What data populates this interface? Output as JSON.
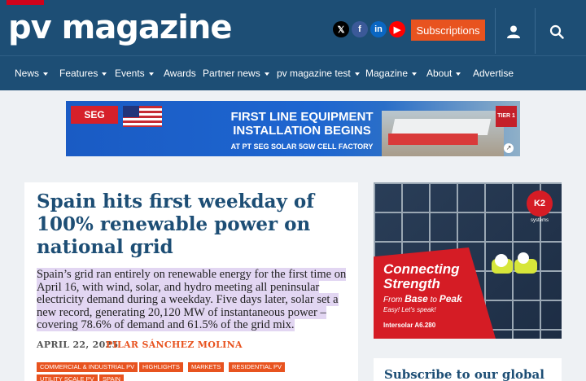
{
  "header": {
    "logo": "pv magazine",
    "social": [
      {
        "name": "x-icon",
        "glyph": "𝕏",
        "color": "#000000"
      },
      {
        "name": "facebook-icon",
        "glyph": "f",
        "color": "#3b5998"
      },
      {
        "name": "linkedin-icon",
        "glyph": "in",
        "color": "#0a66c2"
      },
      {
        "name": "youtube-icon",
        "glyph": "▶",
        "color": "#ff0000"
      }
    ],
    "subscriptions_label": "Subscriptions"
  },
  "nav": {
    "items": [
      {
        "label": "News",
        "has_dropdown": true
      },
      {
        "label": "Features",
        "has_dropdown": true
      },
      {
        "label": "Events",
        "has_dropdown": true
      },
      {
        "label": "Awards",
        "has_dropdown": false
      },
      {
        "label": "Partner news",
        "has_dropdown": true
      },
      {
        "label": "pv magazine test",
        "has_dropdown": true
      },
      {
        "label": "Magazine",
        "has_dropdown": true
      },
      {
        "label": "About",
        "has_dropdown": true
      },
      {
        "label": "Advertise",
        "has_dropdown": false
      }
    ]
  },
  "banner_ad": {
    "brand": "SEG",
    "headline_1": "FIRST LINE EQUIPMENT",
    "headline_2": "INSTALLATION BEGINS",
    "subline": "AT PT SEG SOLAR 5GW CELL FACTORY",
    "badge": "TIER 1"
  },
  "article": {
    "title": "Spain hits first weekday of 100% renewable power on national grid",
    "lead": "Spain’s grid ran entirely on renewable energy for the first time on April 16, with wind, solar, and hydro meeting all peninsular electricity demand during a weekday. Five days later, solar set a new record, generating 20,120 MW of instantaneous power – covering 78.6% of demand and 61.5% of the grid mix.",
    "date": "APRIL 22, 2025",
    "author": "PILAR SÁNCHEZ MOLINA",
    "tags": [
      "COMMERCIAL & INDUSTRIAL PV",
      "HIGHLIGHTS",
      "MARKETS",
      "RESIDENTIAL PV",
      "UTILITY SCALE PV",
      "SPAIN"
    ]
  },
  "side_ad": {
    "logo": "K2",
    "logo_sub": "systems",
    "heading_1": "Connecting",
    "heading_2": "Strength",
    "line_from": "From",
    "line_base": "Base",
    "line_to": "to",
    "line_peak": "Peak",
    "small": "Easy! Let's speak!",
    "footer": "Intersolar  A6.280"
  },
  "sidebar": {
    "subscribe_title": "Subscribe to our global"
  },
  "colors": {
    "brand_blue": "#1d4e75",
    "accent_orange": "#e8531f",
    "highlight": "#e2d6f2"
  }
}
